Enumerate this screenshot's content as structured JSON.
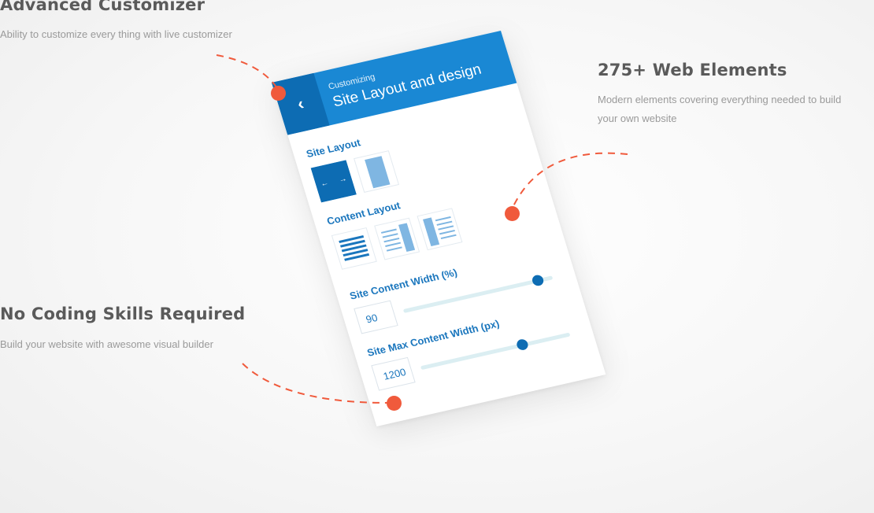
{
  "features": [
    {
      "title": "Advanced Customizer",
      "desc": [
        "Ability to customize every thing with live customizer"
      ]
    },
    {
      "title": "275+ Web Elements",
      "desc": [
        "Modern  elements covering everything needed to build",
        "your own website"
      ]
    },
    {
      "title": "No Coding Skills Required",
      "desc": [
        "Build your  website with awesome visual builder"
      ]
    }
  ],
  "colors": {
    "accent_dot": "#f05a3c",
    "header_blue": "#1a88d4",
    "header_dark_blue": "#0d6cb3",
    "label_blue": "#1a76bd"
  },
  "panel": {
    "subtitle": "Customizing",
    "title": "Site Layout and design",
    "back_icon": "chevron-left-icon",
    "back_glyph": "‹",
    "site_layout": {
      "label": "Site Layout",
      "options": [
        "full-width",
        "boxed"
      ],
      "selected": "full-width"
    },
    "content_layout": {
      "label": "Content Layout",
      "options": [
        "no-sidebar",
        "right-sidebar",
        "left-sidebar"
      ]
    },
    "content_width": {
      "label": "Site Content Width (%)",
      "value": "90",
      "slider_fraction": 0.9
    },
    "max_width": {
      "label": "Site Max Content Width (px)",
      "value": "1200",
      "slider_fraction": 0.68
    }
  }
}
